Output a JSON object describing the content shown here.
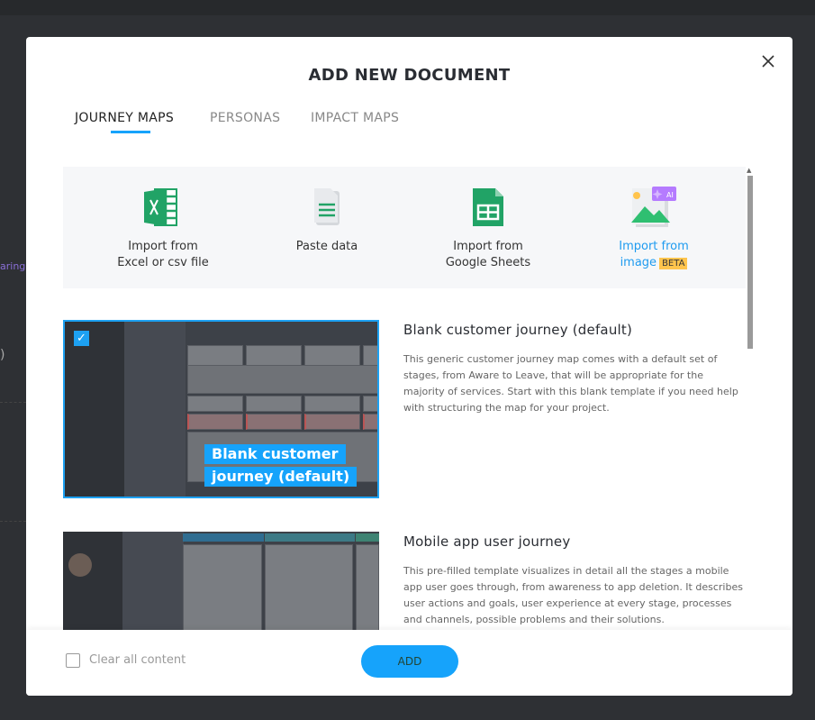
{
  "background": {
    "fragment": "aring",
    "fragment2": ")"
  },
  "modal": {
    "title": "ADD NEW DOCUMENT",
    "tabs": [
      {
        "label": "JOURNEY MAPS",
        "active": true
      },
      {
        "label": "PERSONAS"
      },
      {
        "label": "IMPACT MAPS"
      }
    ],
    "imports": [
      {
        "line1": "Import from",
        "line2": "Excel or csv file",
        "icon": "excel-icon"
      },
      {
        "line1": "Paste data",
        "line2": "",
        "icon": "paste-document-icon"
      },
      {
        "line1": "Import from",
        "line2": "Google Sheets",
        "icon": "google-sheets-icon"
      },
      {
        "line1": "Import from",
        "line2": "image",
        "badge": "BETA",
        "ai_badge": "AI",
        "icon": "image-ai-icon"
      }
    ],
    "templates": [
      {
        "title": "Blank customer journey (default)",
        "overlay1": "Blank customer",
        "overlay2": "journey (default)",
        "selected": true,
        "description": "This generic customer journey map comes with a default set of stages, from Aware to Leave, that will be appropriate for the majority of services. Start with this blank template if you need help with structuring the map for your project."
      },
      {
        "title": "Mobile app user journey",
        "selected": false,
        "description": "This pre-filled template visualizes in detail all the stages a mobile app user goes through, from awareness to app deletion. It describes user actions and goals, user experience at every stage, processes and channels, possible problems and their solutions."
      }
    ],
    "footer": {
      "clear_label": "Clear all content",
      "clear_checked": false,
      "add_label": "ADD"
    }
  },
  "colors": {
    "accent": "#16a3fb",
    "beta": "#ffc44d",
    "green": "#21a366"
  }
}
